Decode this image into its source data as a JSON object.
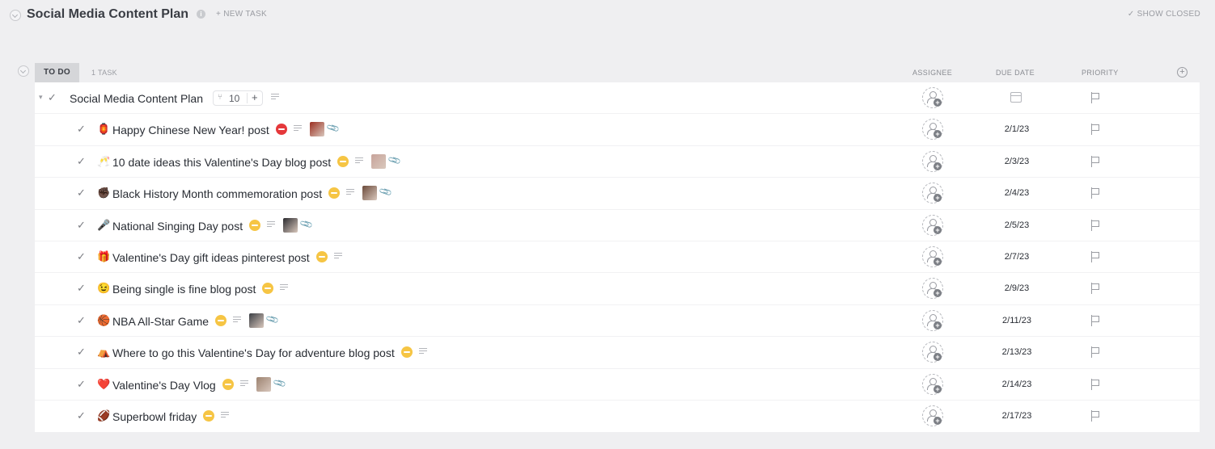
{
  "header": {
    "title": "Social Media Content Plan",
    "info_icon": "info-icon",
    "new_task": "+ NEW TASK",
    "show_closed": "✓ SHOW CLOSED"
  },
  "group": {
    "status": "TO DO",
    "count": "1 TASK",
    "columns": {
      "assignee": "ASSIGNEE",
      "due_date": "DUE DATE",
      "priority": "PRIORITY"
    },
    "add_column_icon": "plus-circle-icon"
  },
  "parent_task": {
    "name": "Social Media Content Plan",
    "subtask_count": "10",
    "add_label": "+"
  },
  "colors": {
    "status_red": "#e5383b",
    "status_yellow": "#f6c544",
    "accent_gray": "#d5d6d9"
  },
  "subtasks": [
    {
      "emoji": "🏮",
      "name": "Happy Chinese New Year! post",
      "status": "red",
      "due": "2/1/23",
      "thumb": "#9b2d1f",
      "has_attachment": true
    },
    {
      "emoji": "🥂",
      "name": "10 date ideas this Valentine's Day blog post",
      "status": "yellow",
      "due": "2/3/23",
      "thumb": "#c7a39a",
      "has_attachment": true
    },
    {
      "emoji": "✊🏿",
      "name": "Black History Month commemoration post",
      "status": "yellow",
      "due": "2/4/23",
      "thumb": "#6b4a3a",
      "has_attachment": true
    },
    {
      "emoji": "🎤",
      "name": "National Singing Day post",
      "status": "yellow",
      "due": "2/5/23",
      "thumb": "#2a2a2e",
      "has_attachment": true
    },
    {
      "emoji": "🎁",
      "name": "Valentine's Day gift ideas pinterest post",
      "status": "yellow",
      "due": "2/7/23",
      "thumb": null,
      "has_attachment": false
    },
    {
      "emoji": "😉",
      "name": "Being single is fine blog post",
      "status": "yellow",
      "due": "2/9/23",
      "thumb": null,
      "has_attachment": false
    },
    {
      "emoji": "🏀",
      "name": "NBA All-Star Game",
      "status": "yellow",
      "due": "2/11/23",
      "thumb": "#3b3f45",
      "has_attachment": true
    },
    {
      "emoji": "⛺",
      "name": "Where to go this Valentine's Day for adventure blog post",
      "status": "yellow",
      "due": "2/13/23",
      "thumb": null,
      "has_attachment": false
    },
    {
      "emoji": "❤️",
      "name": "Valentine's Day Vlog",
      "status": "yellow",
      "due": "2/14/23",
      "thumb": "#9c8270",
      "has_attachment": true
    },
    {
      "emoji": "🏈",
      "name": "Superbowl friday",
      "status": "yellow",
      "due": "2/17/23",
      "thumb": null,
      "has_attachment": false
    }
  ]
}
